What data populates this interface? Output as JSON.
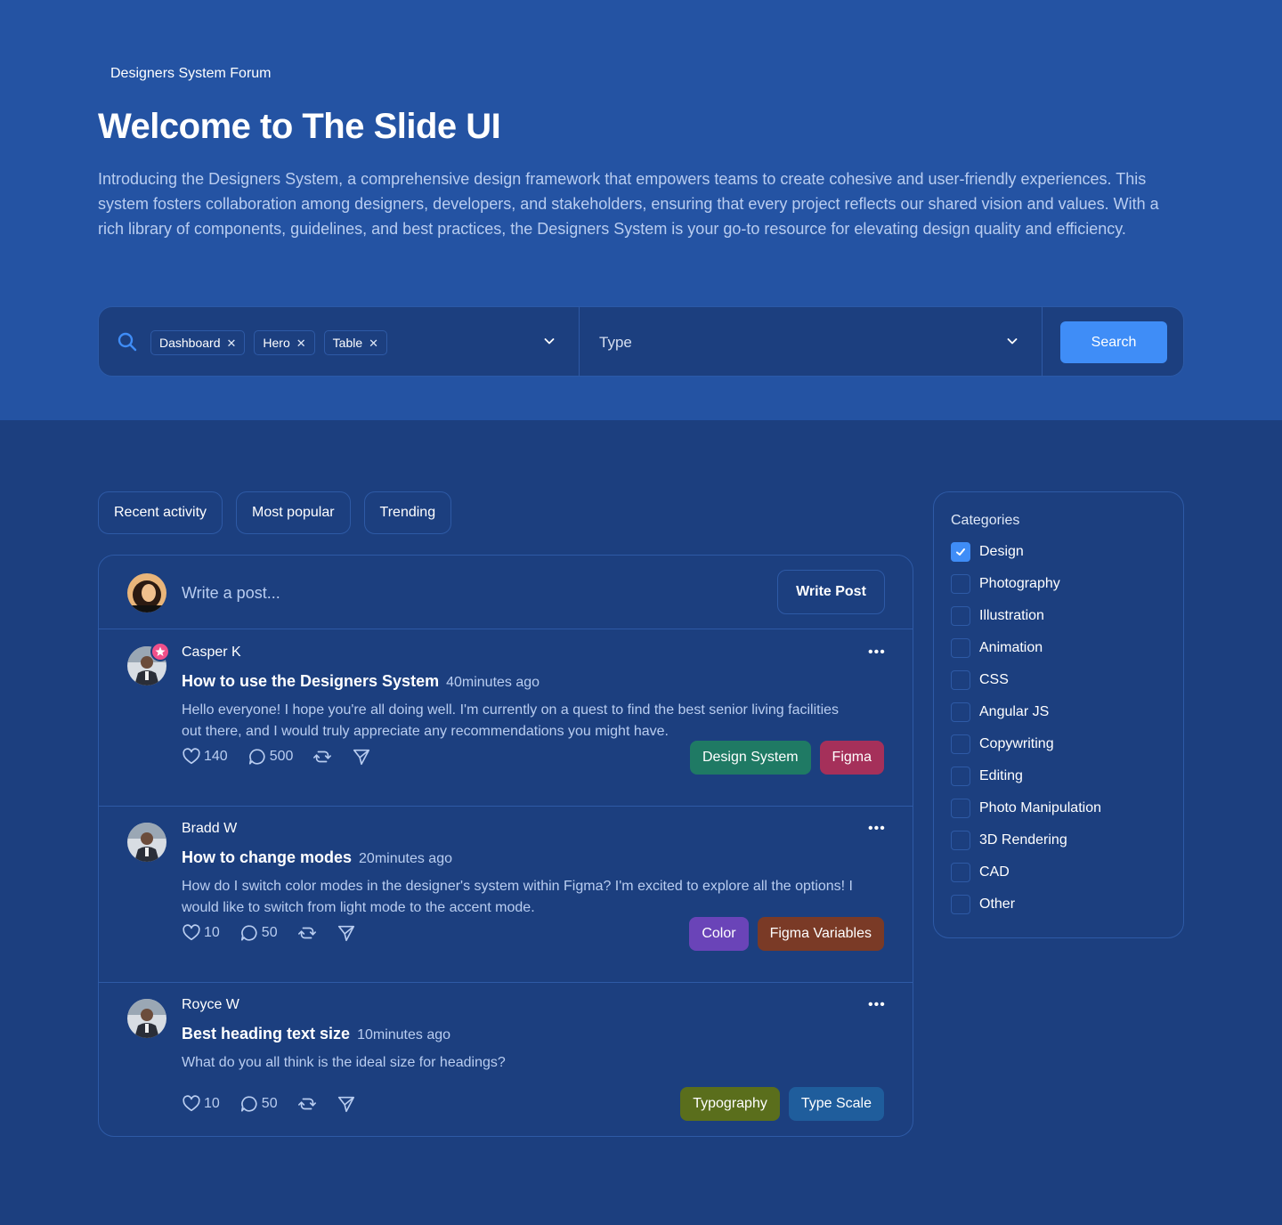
{
  "hero": {
    "breadcrumb": "Designers System Forum",
    "title": "Welcome to The Slide UI",
    "description": "Introducing the Designers System, a comprehensive design framework that empowers teams to create cohesive and user-friendly experiences. This system fosters collaboration among designers, developers, and stakeholders, ensuring that every project reflects our shared vision and values. With a rich library of components, guidelines, and best practices, the Designers System is your go-to resource for elevating design quality and efficiency."
  },
  "search": {
    "chips": [
      "Dashboard",
      "Hero",
      "Table"
    ],
    "type_label": "Type",
    "button_label": "Search"
  },
  "tabs": [
    "Recent activity",
    "Most popular",
    "Trending"
  ],
  "compose": {
    "placeholder": "Write a post...",
    "button_label": "Write Post"
  },
  "posts": [
    {
      "author": "Casper K",
      "title": "How to use the Designers System",
      "time": "40minutes ago",
      "body": "Hello everyone! I hope you're all doing well. I'm currently on a quest to find the best senior living facilities out there, and I would truly appreciate any recommendations you might have.",
      "likes": "140",
      "comments": "500",
      "tags": [
        {
          "label": "Design System",
          "color": "#1f7a64"
        },
        {
          "label": "Figma",
          "color": "#a5305a"
        }
      ]
    },
    {
      "author": "Bradd W",
      "title": "How to change modes",
      "time": "20minutes ago",
      "body": "How do I switch color modes in the designer's system within Figma? I'm excited to explore all the options! I would like to switch from light mode to the accent mode.",
      "likes": "10",
      "comments": "50",
      "tags": [
        {
          "label": "Color",
          "color": "#6a44b8"
        },
        {
          "label": "Figma Variables",
          "color": "#7a3a26"
        }
      ]
    },
    {
      "author": "Royce W",
      "title": "Best heading text size",
      "time": "10minutes ago",
      "body": "What do you all think is the ideal size for headings?",
      "likes": "10",
      "comments": "50",
      "tags": [
        {
          "label": "Typography",
          "color": "#5a6e1c"
        },
        {
          "label": "Type Scale",
          "color": "#1f5d9c"
        }
      ]
    }
  ],
  "categories": {
    "title": "Categories",
    "items": [
      {
        "label": "Design",
        "checked": true
      },
      {
        "label": "Photography",
        "checked": false
      },
      {
        "label": "Illustration",
        "checked": false
      },
      {
        "label": "Animation",
        "checked": false
      },
      {
        "label": "CSS",
        "checked": false
      },
      {
        "label": "Angular JS",
        "checked": false
      },
      {
        "label": "Copywriting",
        "checked": false
      },
      {
        "label": "Editing",
        "checked": false
      },
      {
        "label": "Photo Manipulation",
        "checked": false
      },
      {
        "label": "3D Rendering",
        "checked": false
      },
      {
        "label": "CAD",
        "checked": false
      },
      {
        "label": "Other",
        "checked": false
      }
    ]
  },
  "colors": {
    "hero_bg": "#2453a3",
    "page_bg": "#1c3f7f",
    "accent": "#3f8df7",
    "border": "#2e5aa6"
  },
  "icons": [
    "search-icon",
    "close-icon",
    "chevron-down-icon",
    "heart-icon",
    "comment-icon",
    "repost-icon",
    "send-icon",
    "more-icon",
    "check-icon",
    "star-icon"
  ]
}
